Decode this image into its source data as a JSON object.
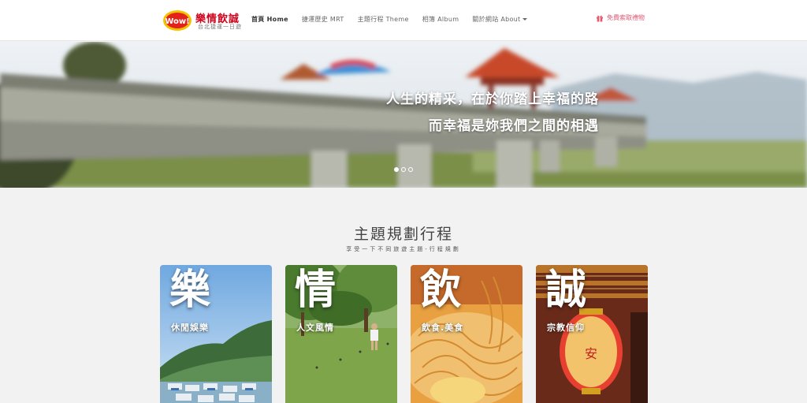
{
  "brand": {
    "title": "樂情飲誠",
    "subtitle": "台北捷運一日遊",
    "logo_text": "Wow!"
  },
  "nav": {
    "items": [
      {
        "label": "首頁 Home",
        "active": true
      },
      {
        "label": "捷運歷史 MRT",
        "active": false
      },
      {
        "label": "主題行程 Theme",
        "active": false
      },
      {
        "label": "相簿 Album",
        "active": false
      },
      {
        "label": "關於網站 About",
        "active": false,
        "dropdown": true
      }
    ],
    "gift_label": "免費索取禮物",
    "gift_icon": "gift-icon"
  },
  "hero": {
    "line1": "人生的精采，在於你踏上幸福的路",
    "line2": "而幸福是妳我們之間的相遇",
    "slides": 3,
    "active_slide": 1
  },
  "section": {
    "title": "主題規劃行程",
    "subtitle": "享受一下不同旅遊主題-行程規劃"
  },
  "cards": [
    {
      "big": "樂",
      "small": "休閒娛樂"
    },
    {
      "big": "情",
      "small": "人文風情"
    },
    {
      "big": "飲",
      "small": "飲食.美食"
    },
    {
      "big": "誠",
      "small": "宗教信仰"
    }
  ],
  "colors": {
    "brand_red": "#d0021b",
    "gift_pink": "#e05a74",
    "page_bg": "#f2f2f2"
  }
}
